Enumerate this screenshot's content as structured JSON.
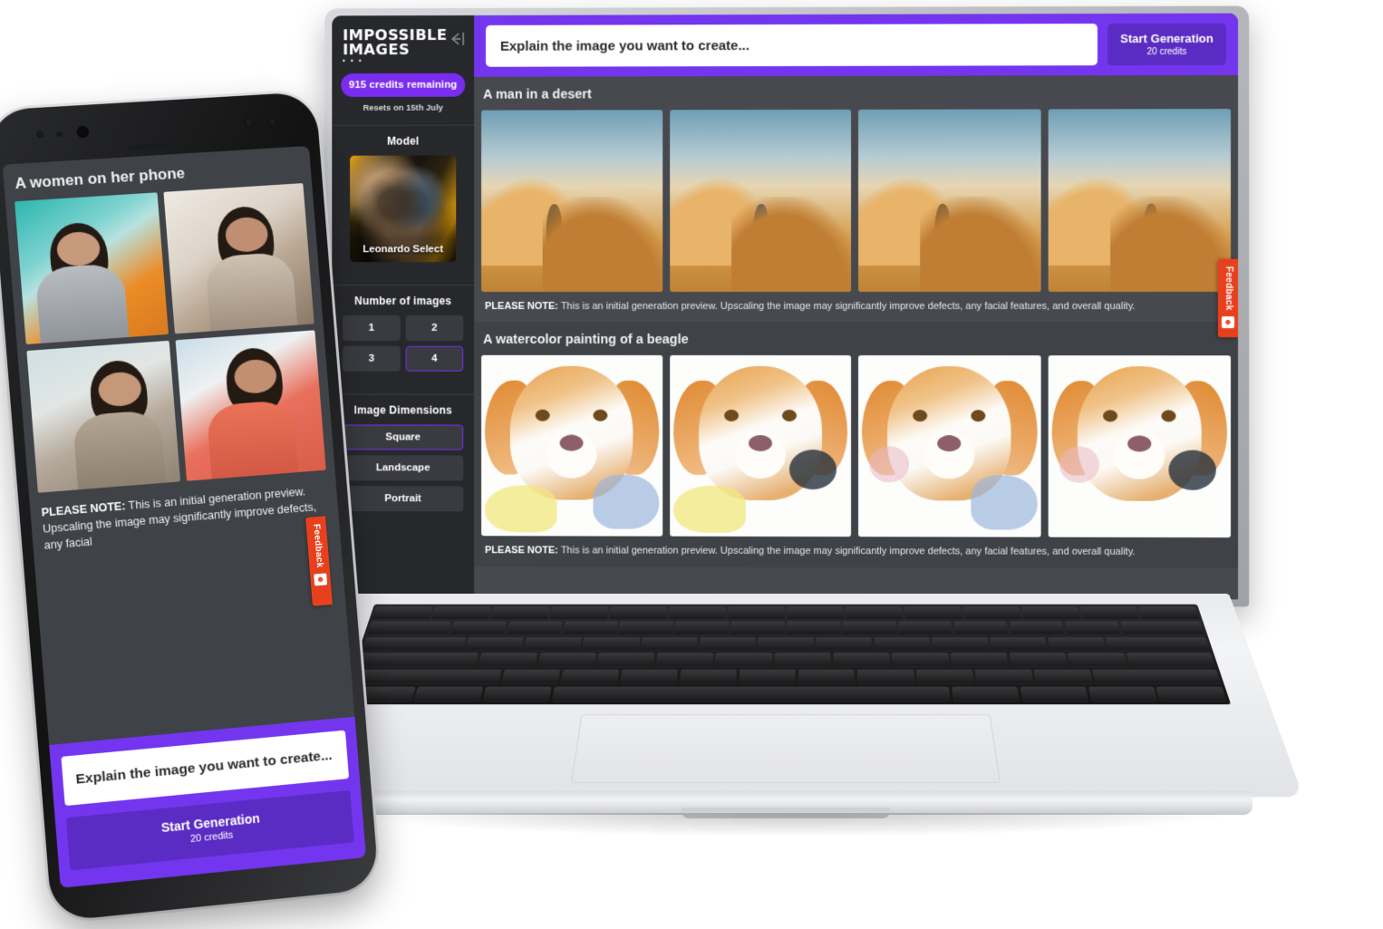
{
  "brand": {
    "line1": "IMPOSSIBLE",
    "line2": "IMAGES",
    "dots": "▪ ▪ ▪",
    "collapse_icon": "collapse-sidebar-icon"
  },
  "sidebar": {
    "credits_pill": "915 credits remaining",
    "resets_label": "Resets on 15th July",
    "model": {
      "title": "Model",
      "selected_name": "Leonardo Select"
    },
    "number_of_images": {
      "title": "Number of images",
      "options": [
        "1",
        "2",
        "3",
        "4"
      ],
      "selected": "4"
    },
    "image_dimensions": {
      "title": "Image Dimensions",
      "options": [
        "Square",
        "Landscape",
        "Portrait"
      ],
      "selected": "Square"
    }
  },
  "prompt_bar": {
    "placeholder": "Explain the image you want to create...",
    "value": "",
    "generate_label": "Start Generation",
    "generate_cost": "20 credits"
  },
  "results": [
    {
      "title": "A man in a desert",
      "note_prefix": "PLEASE NOTE:",
      "note_body": " This is an initial generation preview. Upscaling the image may significantly improve defects, any facial features, and overall quality.",
      "images": [
        "desert-figure-1",
        "desert-figure-2",
        "desert-figure-3",
        "desert-figure-4"
      ]
    },
    {
      "title": "A watercolor painting of a beagle",
      "note_prefix": "PLEASE NOTE:",
      "note_body": " This is an initial generation preview. Upscaling the image may significantly improve defects, any facial features, and overall quality.",
      "images": [
        "beagle-watercolor-1",
        "beagle-watercolor-2",
        "beagle-watercolor-3",
        "beagle-watercolor-4"
      ]
    }
  ],
  "feedback_tab": {
    "label": "Feedback",
    "icon": "feedback-smiley-icon"
  },
  "phone": {
    "title": "A women on her phone",
    "images": [
      "woman-phone-1",
      "woman-phone-2",
      "woman-phone-3",
      "woman-phone-4"
    ],
    "note_prefix": "PLEASE NOTE:",
    "note_body": " This is an initial generation preview. Upscaling the image may significantly improve defects, any facial",
    "prompt_placeholder": "Explain the image you want to create...",
    "generate_label": "Start Generation",
    "generate_cost": "20 credits"
  },
  "colors": {
    "accent_purple": "#7435ef",
    "accent_purple_dark": "#5b2cc4",
    "credits_purple": "#7a2df0",
    "sidebar_bg": "#27282c",
    "main_bg": "#47494e",
    "panel_bg": "#3f4246",
    "feedback_orange": "#e8401c"
  }
}
